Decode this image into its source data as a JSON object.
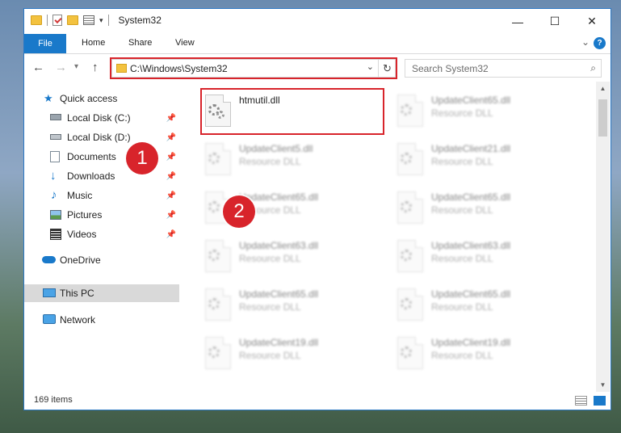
{
  "window": {
    "title": "System32",
    "controls": [
      "minimize-icon",
      "maximize-icon",
      "close-icon"
    ]
  },
  "ribbon": {
    "tabs": [
      {
        "label": "File",
        "active": true
      },
      {
        "label": "Home"
      },
      {
        "label": "Share"
      },
      {
        "label": "View"
      }
    ]
  },
  "nav": {
    "address": "C:\\Windows\\System32",
    "search_placeholder": "Search System32"
  },
  "sidebar": {
    "items": [
      {
        "label": "Quick access",
        "icon": "star-icon",
        "pinned": false
      },
      {
        "label": "Local Disk (C:)",
        "icon": "drive-icon",
        "pinned": true
      },
      {
        "label": "Local Disk (D:)",
        "icon": "drive-icon",
        "pinned": true
      },
      {
        "label": "Documents",
        "icon": "documents-icon",
        "pinned": true
      },
      {
        "label": "Downloads",
        "icon": "downloads-icon",
        "pinned": true
      },
      {
        "label": "Music",
        "icon": "music-icon",
        "pinned": true
      },
      {
        "label": "Pictures",
        "icon": "pictures-icon",
        "pinned": true
      },
      {
        "label": "Videos",
        "icon": "videos-icon",
        "pinned": true
      },
      {
        "label": "OneDrive",
        "icon": "onedrive-icon",
        "pinned": false
      },
      {
        "label": "This PC",
        "icon": "computer-icon",
        "pinned": false,
        "selected": true
      },
      {
        "label": "Network",
        "icon": "network-icon",
        "pinned": false
      }
    ]
  },
  "files": [
    {
      "name": "htmutil.dll",
      "type": "",
      "highlighted": true
    },
    {
      "name": "UpdateClient65.dll",
      "type": "Resource DLL"
    },
    {
      "name": "UpdateClient5.dll",
      "type": "Resource DLL"
    },
    {
      "name": "UpdateClient21.dll",
      "type": "Resource DLL"
    },
    {
      "name": "UpdateClient65.dll",
      "type": "Resource DLL"
    },
    {
      "name": "UpdateClient65.dll",
      "type": "Resource DLL"
    },
    {
      "name": "UpdateClient63.dll",
      "type": "Resource DLL"
    },
    {
      "name": "UpdateClient63.dll",
      "type": "Resource DLL"
    },
    {
      "name": "UpdateClient65.dll",
      "type": "Resource DLL"
    },
    {
      "name": "UpdateClient65.dll",
      "type": "Resource DLL"
    },
    {
      "name": "UpdateClient19.dll",
      "type": "Resource DLL"
    },
    {
      "name": "UpdateClient19.dll",
      "type": "Resource DLL"
    }
  ],
  "status": {
    "count": "169 items"
  },
  "annotations": {
    "step1": "1",
    "step2": "2",
    "color": "#d8242b"
  },
  "colors": {
    "accent": "#1979ca",
    "highlight": "#d8242b",
    "selection": "#d9d9d9"
  }
}
